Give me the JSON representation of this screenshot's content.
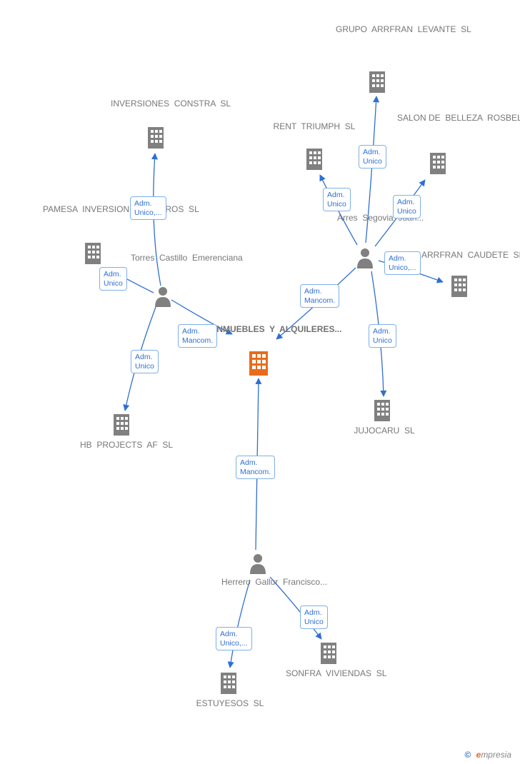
{
  "focal": {
    "name": "INMUEBLES  Y  ALQUILERES..."
  },
  "companies": {
    "inversiones_constra": "INVERSIONES  CONSTRA  SL",
    "pamesa": "PAMESA  INVERSIONES  Y OTROS  SL",
    "hb_projects": "HB  PROJECTS  AF  SL",
    "grupo_arrfran": "GRUPO  ARRFRAN  LEVANTE  SL",
    "rent_triumph": "RENT  TRIUMPH  SL",
    "salon_rosbel": "SALON DE  BELLEZA  ROSBEL  SL",
    "arrfran_caudete": "ARRFRAN  CAUDETE  SL",
    "jujocaru": "JUJOCARU  SL",
    "estuyesos": "ESTUYESOS  SL",
    "sonfra": "SONFRA  VIVIENDAS  SL"
  },
  "people": {
    "torres_castillo": "Torres  Castillo  Emerenciana",
    "arres_segovia": "Arres  Segovia  Juan...",
    "herrero_gallur": "Herrero  Gallur  Francisco..."
  },
  "edge_labels": {
    "adm_unico": "Adm.\nUnico",
    "adm_unico_ell": "Adm.\nUnico,...",
    "adm_mancom": "Adm.\nMancom."
  },
  "watermark": {
    "copyright": "©",
    "brand_e": "e",
    "brand_rest": "mpresia"
  }
}
